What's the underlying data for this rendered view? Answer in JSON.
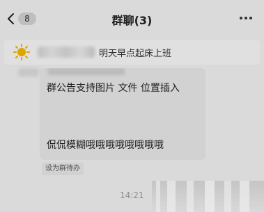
{
  "header": {
    "back_count": "8",
    "title": "群聊(3)"
  },
  "notice": {
    "text": "明天早点起床上班"
  },
  "message": {
    "line1": "群公告支持图片 文件 位置插入",
    "line2": "侃侃模糊哦哦哦哦哦哦哦哦",
    "todo_label": "设为群待办"
  },
  "time": {
    "label": "14:21"
  }
}
